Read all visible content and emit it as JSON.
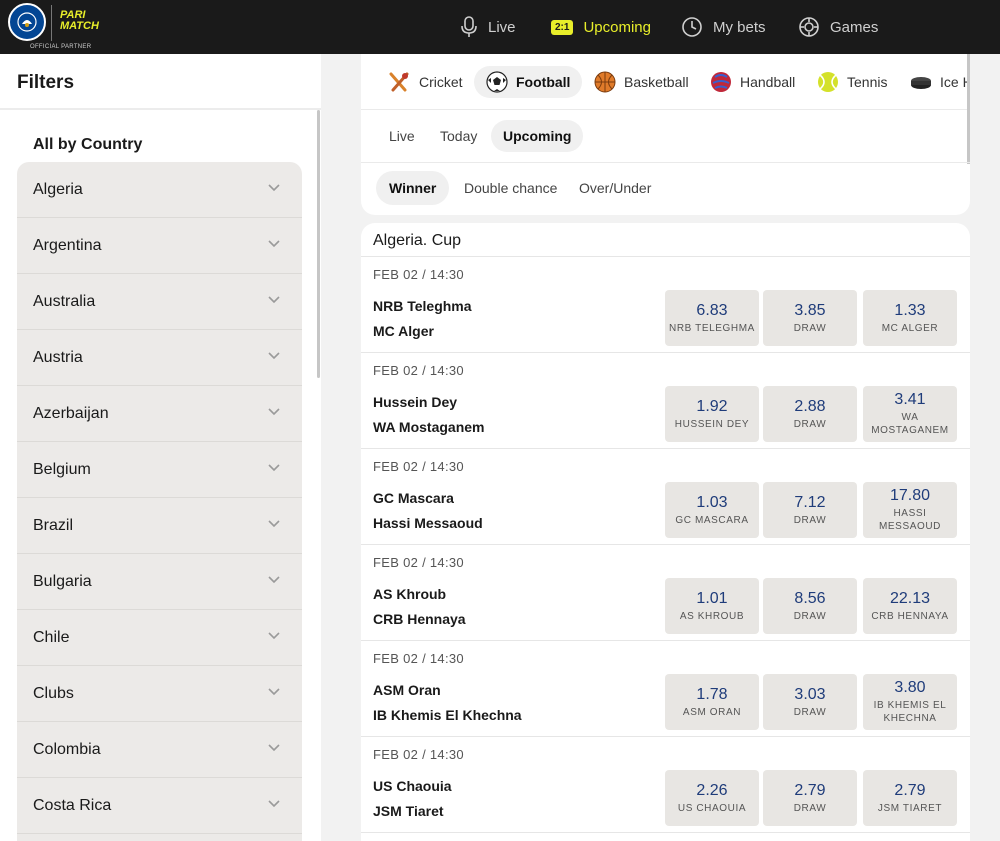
{
  "brand": {
    "partner_text": "OFFICIAL PARTNER",
    "sponsor_line1": "PARI",
    "sponsor_line2": "MATCH"
  },
  "nav": [
    {
      "label": "Live",
      "icon": "microphone-icon",
      "active": false
    },
    {
      "label": "Upcoming",
      "icon": "score-badge-icon",
      "badge": "2:1",
      "active": true
    },
    {
      "label": "My bets",
      "icon": "clock-icon",
      "active": false
    },
    {
      "label": "Games",
      "icon": "chip-icon",
      "active": false
    }
  ],
  "colors": {
    "accent": "#e8ee2a",
    "odds": "#1f3c7a",
    "topbar": "#1a1a1a"
  },
  "sidebar": {
    "title": "Filters",
    "section_title": "All by Country",
    "countries": [
      "Algeria",
      "Argentina",
      "Australia",
      "Austria",
      "Azerbaijan",
      "Belgium",
      "Brazil",
      "Bulgaria",
      "Chile",
      "Clubs",
      "Colombia",
      "Costa Rica"
    ]
  },
  "sports": [
    {
      "label": "Cricket",
      "icon": "cricket-icon",
      "active": false
    },
    {
      "label": "Football",
      "icon": "football-icon",
      "active": true
    },
    {
      "label": "Basketball",
      "icon": "basketball-icon",
      "active": false
    },
    {
      "label": "Handball",
      "icon": "handball-icon",
      "active": false
    },
    {
      "label": "Tennis",
      "icon": "tennis-icon",
      "active": false
    },
    {
      "label": "Ice H",
      "icon": "ice-hockey-icon",
      "active": false
    }
  ],
  "time_tabs": [
    {
      "label": "Live",
      "active": false
    },
    {
      "label": "Today",
      "active": false
    },
    {
      "label": "Upcoming",
      "active": true
    }
  ],
  "market_tabs": [
    {
      "label": "Winner",
      "active": true
    },
    {
      "label": "Double chance",
      "active": false
    },
    {
      "label": "Over/Under",
      "active": false
    }
  ],
  "league": {
    "title": "Algeria. Cup",
    "matches": [
      {
        "time": "FEB 02 / 14:30",
        "home": "NRB Teleghma",
        "away": "MC Alger",
        "odds": [
          {
            "value": "6.83",
            "label": "NRB TELEGHMA"
          },
          {
            "value": "3.85",
            "label": "DRAW"
          },
          {
            "value": "1.33",
            "label": "MC ALGER"
          }
        ]
      },
      {
        "time": "FEB 02 / 14:30",
        "home": "Hussein Dey",
        "away": "WA Mostaganem",
        "odds": [
          {
            "value": "1.92",
            "label": "HUSSEIN DEY"
          },
          {
            "value": "2.88",
            "label": "DRAW"
          },
          {
            "value": "3.41",
            "label": "WA MOSTAGANEM"
          }
        ]
      },
      {
        "time": "FEB 02 / 14:30",
        "home": "GC Mascara",
        "away": "Hassi Messaoud",
        "odds": [
          {
            "value": "1.03",
            "label": "GC MASCARA"
          },
          {
            "value": "7.12",
            "label": "DRAW"
          },
          {
            "value": "17.80",
            "label": "HASSI MESSAOUD"
          }
        ]
      },
      {
        "time": "FEB 02 / 14:30",
        "home": "AS Khroub",
        "away": "CRB Hennaya",
        "odds": [
          {
            "value": "1.01",
            "label": "AS KHROUB"
          },
          {
            "value": "8.56",
            "label": "DRAW"
          },
          {
            "value": "22.13",
            "label": "CRB HENNAYA"
          }
        ]
      },
      {
        "time": "FEB 02 / 14:30",
        "home": "ASM Oran",
        "away": "IB Khemis El Khechna",
        "odds": [
          {
            "value": "1.78",
            "label": "ASM ORAN"
          },
          {
            "value": "3.03",
            "label": "DRAW"
          },
          {
            "value": "3.80",
            "label": "IB KHEMIS EL KHECHNA"
          }
        ]
      },
      {
        "time": "FEB 02 / 14:30",
        "home": "US Chaouia",
        "away": "JSM Tiaret",
        "odds": [
          {
            "value": "2.26",
            "label": "US CHAOUIA"
          },
          {
            "value": "2.79",
            "label": "DRAW"
          },
          {
            "value": "2.79",
            "label": "JSM TIARET"
          }
        ]
      }
    ]
  }
}
